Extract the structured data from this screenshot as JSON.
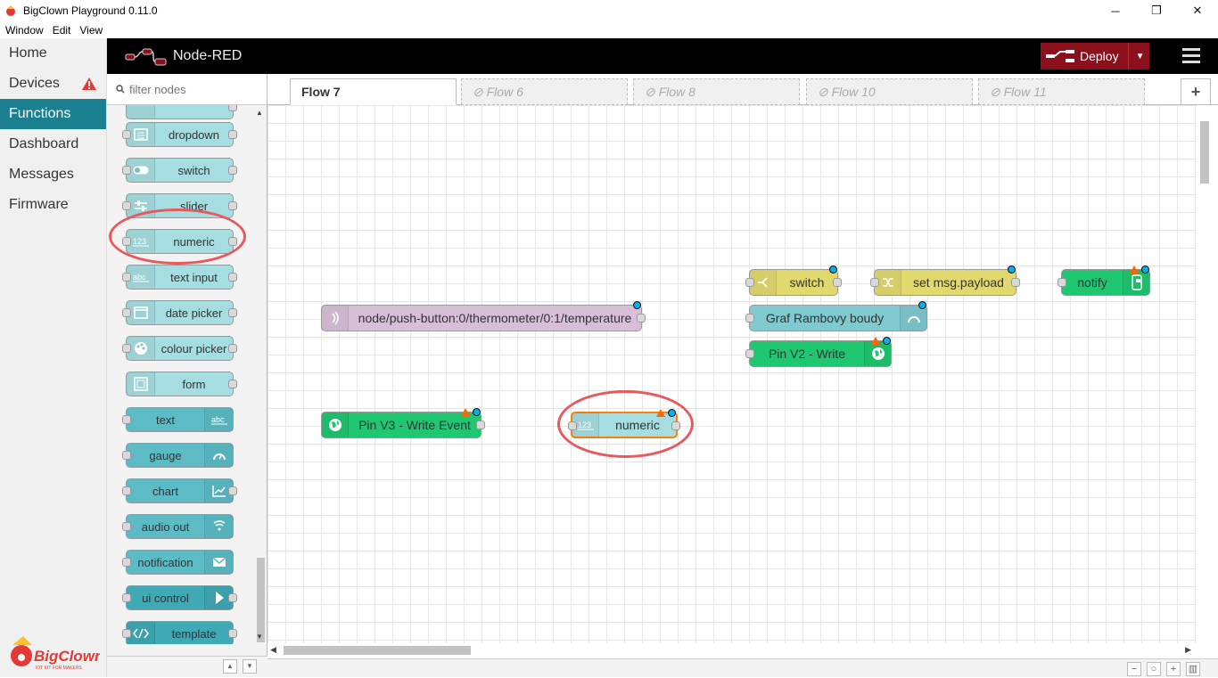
{
  "window": {
    "title": "BigClown Playground 0.11.0",
    "controls": [
      "─",
      "❐",
      "✕"
    ]
  },
  "menu": [
    "Window",
    "Edit",
    "View"
  ],
  "appnav": {
    "items": [
      "Home",
      "Devices",
      "Functions",
      "Dashboard",
      "Messages",
      "Firmware"
    ],
    "active": "Functions",
    "brand": "BigClown",
    "brand_tagline": "IOT KIT FOR MAKERS"
  },
  "header": {
    "title": "Node-RED",
    "deploy_label": "Deploy"
  },
  "palette": {
    "search_placeholder": "filter nodes",
    "nodes": [
      "dropdown",
      "switch",
      "slider",
      "numeric",
      "text input",
      "date picker",
      "colour picker",
      "form",
      "text",
      "gauge",
      "chart",
      "audio out",
      "notification",
      "ui control",
      "template"
    ]
  },
  "tabs": [
    "Flow 7",
    "Flow 6",
    "Flow 8",
    "Flow 10",
    "Flow 11"
  ],
  "flow_nodes": {
    "mqtt_in": "node/push-button:0/thermometer/0:1/temperature",
    "switch": "switch",
    "change": "set msg.payload",
    "notify": "notify",
    "gauge": "Graf Rambovy boudy",
    "pin_v2": "Pin V2 - Write",
    "pin_v3": "Pin V3 - Write Event",
    "numeric": "numeric"
  },
  "colors": {
    "active_nav": "#1a7f8e",
    "deploy": "#8c101c",
    "highlight_circle": "#e8595d",
    "dashboard_light": "#a6dde0",
    "dashboard_dark": "#3fa9b5",
    "function_yellow": "#e2d96e",
    "blynk_green": "#1fc771",
    "mqtt_purple": "#d8bfd8"
  }
}
